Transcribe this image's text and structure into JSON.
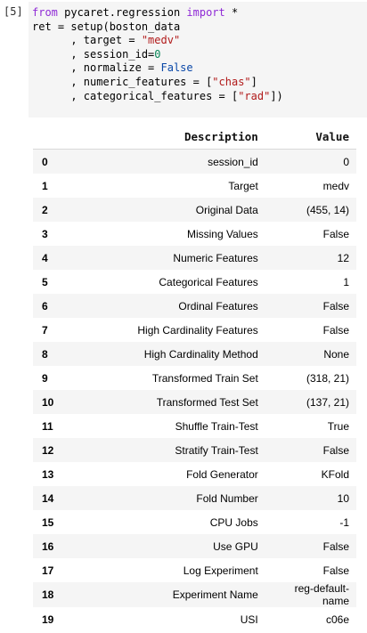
{
  "cell": {
    "prompt": "[5]",
    "code": {
      "l1_kw_from": "from",
      "l1_module": " pycaret.regression ",
      "l1_kw_import": "import",
      "l1_star": " *",
      "l2": "ret = setup(boston_data",
      "l3_prefix": "      , target = ",
      "l3_str": "\"medv\"",
      "l4_prefix": "      , session_id=",
      "l4_num": "0",
      "l5_prefix": "      , normalize = ",
      "l5_bool": "False",
      "l6_prefix": "      , numeric_features = [",
      "l6_str": "\"chas\"",
      "l6_suffix": "]",
      "l7_prefix": "      , categorical_features = [",
      "l7_str": "\"rad\"",
      "l7_suffix": "])"
    }
  },
  "table": {
    "headers": {
      "description": "Description",
      "value": "Value"
    },
    "rows": [
      {
        "idx": "0",
        "description": "session_id",
        "value": "0"
      },
      {
        "idx": "1",
        "description": "Target",
        "value": "medv"
      },
      {
        "idx": "2",
        "description": "Original Data",
        "value": "(455, 14)"
      },
      {
        "idx": "3",
        "description": "Missing Values",
        "value": "False"
      },
      {
        "idx": "4",
        "description": "Numeric Features",
        "value": "12"
      },
      {
        "idx": "5",
        "description": "Categorical Features",
        "value": "1"
      },
      {
        "idx": "6",
        "description": "Ordinal Features",
        "value": "False"
      },
      {
        "idx": "7",
        "description": "High Cardinality Features",
        "value": "False"
      },
      {
        "idx": "8",
        "description": "High Cardinality Method",
        "value": "None"
      },
      {
        "idx": "9",
        "description": "Transformed Train Set",
        "value": "(318, 21)"
      },
      {
        "idx": "10",
        "description": "Transformed Test Set",
        "value": "(137, 21)"
      },
      {
        "idx": "11",
        "description": "Shuffle Train-Test",
        "value": "True"
      },
      {
        "idx": "12",
        "description": "Stratify Train-Test",
        "value": "False"
      },
      {
        "idx": "13",
        "description": "Fold Generator",
        "value": "KFold"
      },
      {
        "idx": "14",
        "description": "Fold Number",
        "value": "10"
      },
      {
        "idx": "15",
        "description": "CPU Jobs",
        "value": "-1"
      },
      {
        "idx": "16",
        "description": "Use GPU",
        "value": "False"
      },
      {
        "idx": "17",
        "description": "Log Experiment",
        "value": "False"
      },
      {
        "idx": "18",
        "description": "Experiment Name",
        "value": "reg-default-name"
      },
      {
        "idx": "19",
        "description": "USI",
        "value": "c06e"
      }
    ]
  }
}
